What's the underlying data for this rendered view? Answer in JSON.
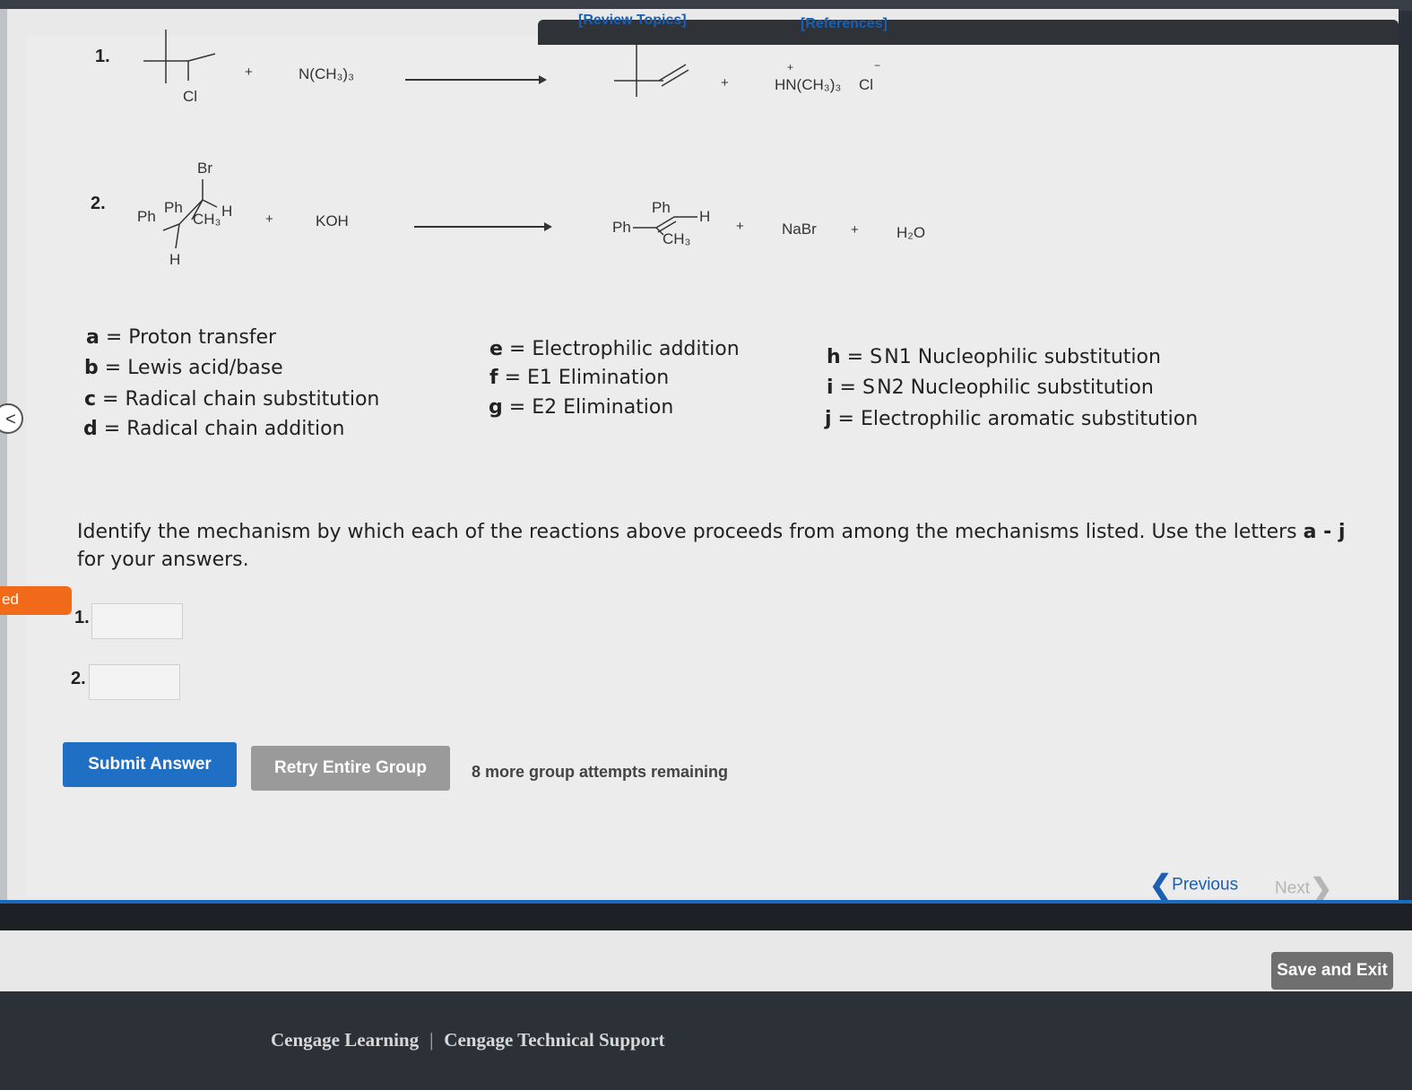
{
  "header": {
    "review_topics": "[Review Topics]",
    "references": "[References]"
  },
  "side": {
    "back_icon": "<",
    "orange_tab": "ed"
  },
  "reactions": {
    "r1": {
      "number": "1.",
      "reactant_cl": "Cl",
      "plus1": "+",
      "reagent": "N(CH₃)₃",
      "plus2": "+",
      "product_salt": "HN(CH₃)₃",
      "product_plus_charge": "+",
      "product_anion": "Cl",
      "anion_charge": "−"
    },
    "r2": {
      "number": "2.",
      "sub_br": "Br",
      "sub_ph_left": "Ph",
      "sub_ph_top": "Ph",
      "sub_ch3": "CH₃",
      "sub_h_right": "H",
      "sub_h_bottom": "H",
      "plus1": "+",
      "reagent": "KOH",
      "prod_ph_left": "Ph",
      "prod_ph_top": "Ph",
      "prod_h": "H",
      "prod_ch3": "CH₃",
      "plus2": "+",
      "nabr": "NaBr",
      "plus3": "+",
      "water": "H₂O"
    }
  },
  "mechanisms": [
    {
      "letter": "a",
      "text": "Proton transfer"
    },
    {
      "letter": "b",
      "text": "Lewis acid/base"
    },
    {
      "letter": "c",
      "text": "Radical chain substitution"
    },
    {
      "letter": "d",
      "text": "Radical chain addition"
    },
    {
      "letter": "e",
      "text": "Electrophilic addition"
    },
    {
      "letter": "f",
      "text": "E1 Elimination"
    },
    {
      "letter": "g",
      "text": "E2 Elimination"
    },
    {
      "letter": "h",
      "text": "S N1 Nucleophilic substitution"
    },
    {
      "letter": "i",
      "text": "S N2 Nucleophilic substitution"
    },
    {
      "letter": "j",
      "text": "Electrophilic aromatic substitution"
    }
  ],
  "eq": "=",
  "question": {
    "text_before": "Identify the mechanism by which each of the reactions above proceeds from among the mechanisms listed. Use the letters ",
    "letters": "a - j",
    "text_after": " for your answers."
  },
  "answers": [
    {
      "label": "1.",
      "value": ""
    },
    {
      "label": "2.",
      "value": ""
    }
  ],
  "buttons": {
    "submit": "Submit Answer",
    "retry": "Retry Entire Group",
    "remaining": "8 more group attempts remaining"
  },
  "nav": {
    "previous": "Previous",
    "next": "Next",
    "prev_icon": "chevron-left",
    "next_icon": "chevron-right"
  },
  "save_exit": "Save and Exit",
  "footer": {
    "link1": "Cengage Learning",
    "sep": "|",
    "link2": "Cengage Technical Support"
  },
  "colors": {
    "submit": "#1f6fc5",
    "retry": "#9a9a9a",
    "link": "#1a5fb4",
    "orange_tab": "#f06a1a"
  }
}
